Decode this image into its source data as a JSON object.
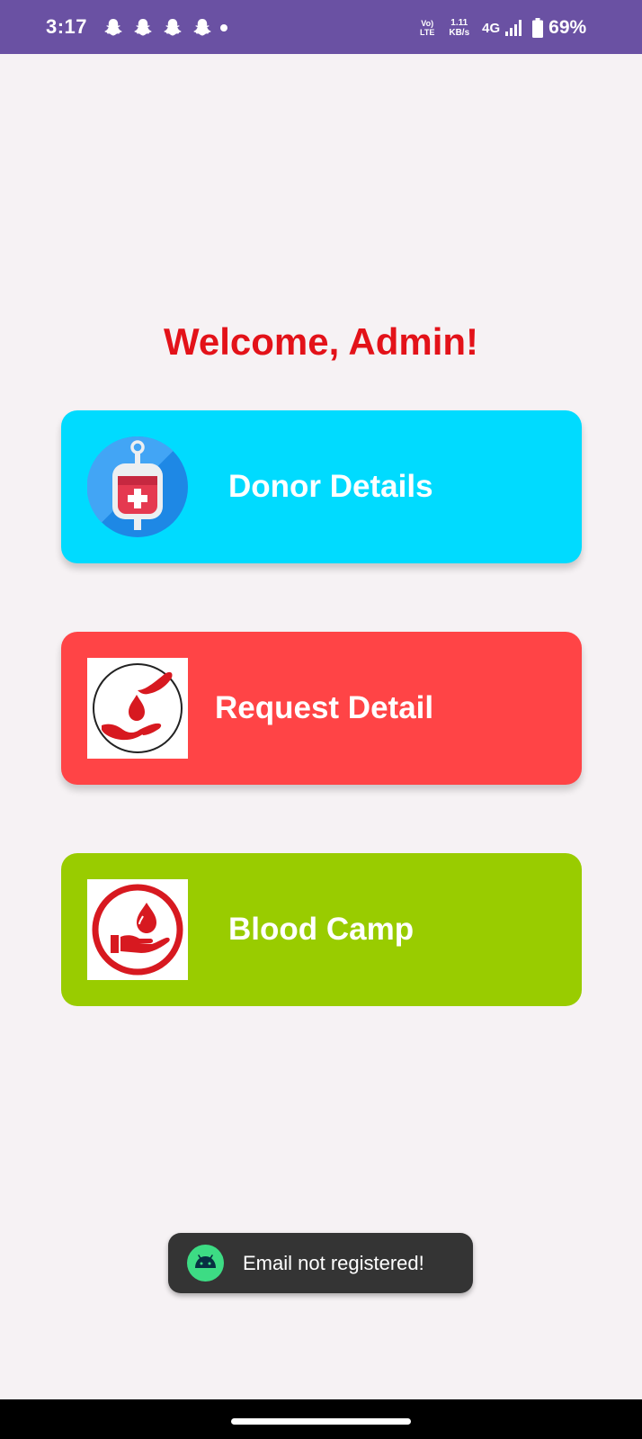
{
  "status_bar": {
    "time": "3:17",
    "notification_icons": [
      "snapchat-icon",
      "snapchat-icon",
      "snapchat-icon",
      "snapchat-icon"
    ],
    "volte_line1": "Vo)",
    "volte_line2": "LTE",
    "net_speed_value": "1.11",
    "net_speed_unit": "KB/s",
    "network_type": "4G",
    "battery_percent": "69%",
    "background": "#6A51A3"
  },
  "main": {
    "welcome_text": "Welcome, Admin!",
    "welcome_color": "#E31219",
    "cards": [
      {
        "label": "Donor Details",
        "color": "#00DBFF",
        "icon": "blood-bag-icon"
      },
      {
        "label": "Request Detail",
        "color": "#FF4446",
        "icon": "blood-drop-hands-icon"
      },
      {
        "label": "Blood Camp",
        "color": "#99CC00",
        "icon": "blood-donation-hand-icon"
      }
    ]
  },
  "toast": {
    "message": "Email not registered!",
    "icon": "android-icon"
  },
  "nav_bar": {
    "home_indicator": "home-pill"
  }
}
